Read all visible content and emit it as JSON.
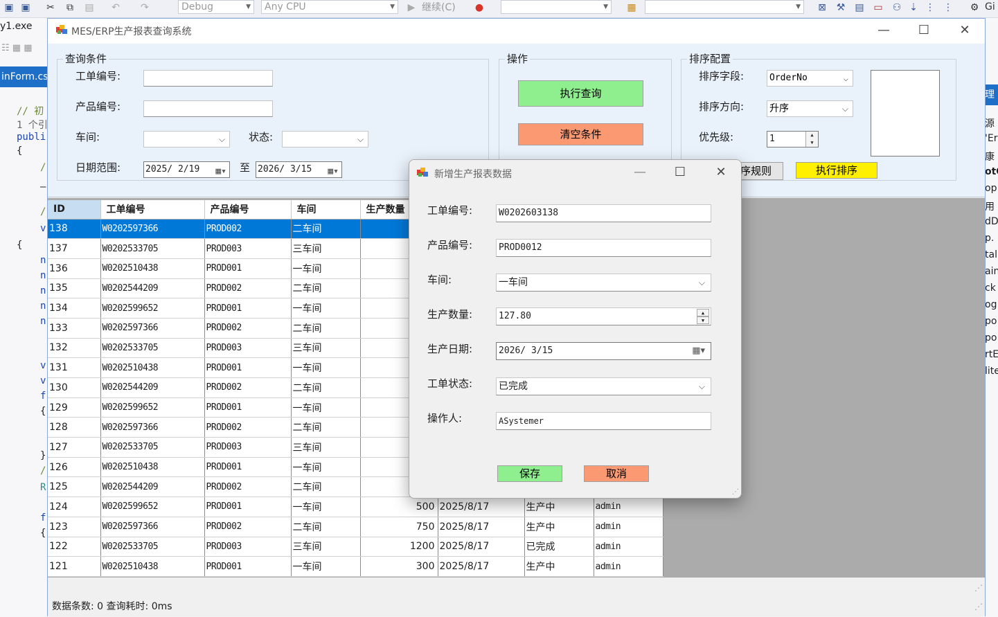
{
  "ide": {
    "debug_combo": "Debug",
    "cpu_combo": "Any CPU",
    "continue_label": "继续(C)",
    "git_label": "Gi",
    "exe_label": "y1.exe",
    "form_tab": "inForm.cs",
    "right_tab": "理",
    "code_lines": [
      "// 初",
      "1 个引",
      "publi",
      "{",
      "/",
      "—",
      "/",
      "v",
      "{",
      "n",
      "n",
      "n",
      "n",
      "n",
      "v",
      "v",
      "f",
      "{",
      "}",
      "/",
      "R",
      "f",
      "{"
    ],
    "right_items": [
      "源",
      "'Er",
      "康",
      "otC",
      "op",
      "用",
      "dD",
      "p.",
      "tal",
      "ain",
      "ck",
      "og",
      "po",
      "po",
      "rtE",
      "lite"
    ]
  },
  "window": {
    "title": "MES/ERP生产报表查询系统",
    "minimize": "—",
    "maximize": "☐",
    "close": "✕"
  },
  "query": {
    "legend": "查询条件",
    "work_order_label": "工单编号:",
    "work_order_value": "",
    "product_label": "产品编号:",
    "product_value": "",
    "workshop_label": "车间:",
    "workshop_value": "",
    "status_label": "状态:",
    "status_value": "",
    "date_label": "日期范围:",
    "date_from": "2025/ 2/19",
    "date_to_label": "至",
    "date_to": "2026/ 3/15"
  },
  "actions": {
    "legend": "操作",
    "execute_query": "执行查询",
    "clear_conditions": "清空条件"
  },
  "sort": {
    "legend": "排序配置",
    "field_label": "排序字段:",
    "field_value": "OrderNo",
    "direction_label": "排序方向:",
    "direction_value": "升序",
    "priority_label": "优先级:",
    "priority_value": "1",
    "rule_button": "序规则",
    "execute_sort": "执行排序"
  },
  "grid": {
    "columns": [
      "ID",
      "工单编号",
      "产品编号",
      "车间",
      "生产数量",
      "",
      "",
      ""
    ],
    "rows": [
      {
        "id": "138",
        "order": "W0202597366",
        "product": "PROD002",
        "workshop": "二车间",
        "qty": "",
        "date": "",
        "status": "",
        "operator": ""
      },
      {
        "id": "137",
        "order": "W0202533705",
        "product": "PROD003",
        "workshop": "三车间",
        "qty": "",
        "date": "",
        "status": "",
        "operator": ""
      },
      {
        "id": "136",
        "order": "W0202510438",
        "product": "PROD001",
        "workshop": "一车间",
        "qty": "",
        "date": "",
        "status": "",
        "operator": ""
      },
      {
        "id": "135",
        "order": "W0202544209",
        "product": "PROD002",
        "workshop": "二车间",
        "qty": "",
        "date": "",
        "status": "",
        "operator": ""
      },
      {
        "id": "134",
        "order": "W0202599652",
        "product": "PROD001",
        "workshop": "一车间",
        "qty": "",
        "date": "",
        "status": "",
        "operator": ""
      },
      {
        "id": "133",
        "order": "W0202597366",
        "product": "PROD002",
        "workshop": "二车间",
        "qty": "",
        "date": "",
        "status": "",
        "operator": ""
      },
      {
        "id": "132",
        "order": "W0202533705",
        "product": "PROD003",
        "workshop": "三车间",
        "qty": "",
        "date": "",
        "status": "",
        "operator": ""
      },
      {
        "id": "131",
        "order": "W0202510438",
        "product": "PROD001",
        "workshop": "一车间",
        "qty": "",
        "date": "",
        "status": "",
        "operator": ""
      },
      {
        "id": "130",
        "order": "W0202544209",
        "product": "PROD002",
        "workshop": "二车间",
        "qty": "",
        "date": "",
        "status": "",
        "operator": ""
      },
      {
        "id": "129",
        "order": "W0202599652",
        "product": "PROD001",
        "workshop": "一车间",
        "qty": "",
        "date": "",
        "status": "",
        "operator": ""
      },
      {
        "id": "128",
        "order": "W0202597366",
        "product": "PROD002",
        "workshop": "二车间",
        "qty": "",
        "date": "",
        "status": "",
        "operator": ""
      },
      {
        "id": "127",
        "order": "W0202533705",
        "product": "PROD003",
        "workshop": "三车间",
        "qty": "",
        "date": "",
        "status": "",
        "operator": ""
      },
      {
        "id": "126",
        "order": "W0202510438",
        "product": "PROD001",
        "workshop": "一车间",
        "qty": "",
        "date": "",
        "status": "",
        "operator": ""
      },
      {
        "id": "125",
        "order": "W0202544209",
        "product": "PROD002",
        "workshop": "二车间",
        "qty": "",
        "date": "",
        "status": "",
        "operator": ""
      },
      {
        "id": "124",
        "order": "W0202599652",
        "product": "PROD001",
        "workshop": "一车间",
        "qty": "500",
        "date": "2025/8/17",
        "status": "生产中",
        "operator": "admin"
      },
      {
        "id": "123",
        "order": "W0202597366",
        "product": "PROD002",
        "workshop": "二车间",
        "qty": "750",
        "date": "2025/8/17",
        "status": "生产中",
        "operator": "admin"
      },
      {
        "id": "122",
        "order": "W0202533705",
        "product": "PROD003",
        "workshop": "三车间",
        "qty": "1200",
        "date": "2025/8/17",
        "status": "已完成",
        "operator": "admin"
      },
      {
        "id": "121",
        "order": "W0202510438",
        "product": "PROD001",
        "workshop": "一车间",
        "qty": "300",
        "date": "2025/8/17",
        "status": "生产中",
        "operator": "admin"
      }
    ]
  },
  "status_bar": {
    "text": "数据条数: 0  查询耗时: 0ms"
  },
  "dialog": {
    "title": "新增生产报表数据",
    "work_order_label": "工单编号:",
    "work_order_value": "W0202603138",
    "product_label": "产品编号:",
    "product_value": "PROD0012",
    "workshop_label": "车间:",
    "workshop_value": "一车间",
    "qty_label": "生产数量:",
    "qty_value": "127.80",
    "date_label": "生产日期:",
    "date_value": "2026/ 3/15",
    "status_label": "工单状态:",
    "status_value": "已完成",
    "operator_label": "操作人:",
    "operator_value": "ASystemer",
    "save": "保存",
    "cancel": "取消"
  },
  "colors": {
    "accent": "#0078d7",
    "query_button": "#8fef8f",
    "clear_button": "#fb9a72",
    "sort_button": "#fff000"
  }
}
